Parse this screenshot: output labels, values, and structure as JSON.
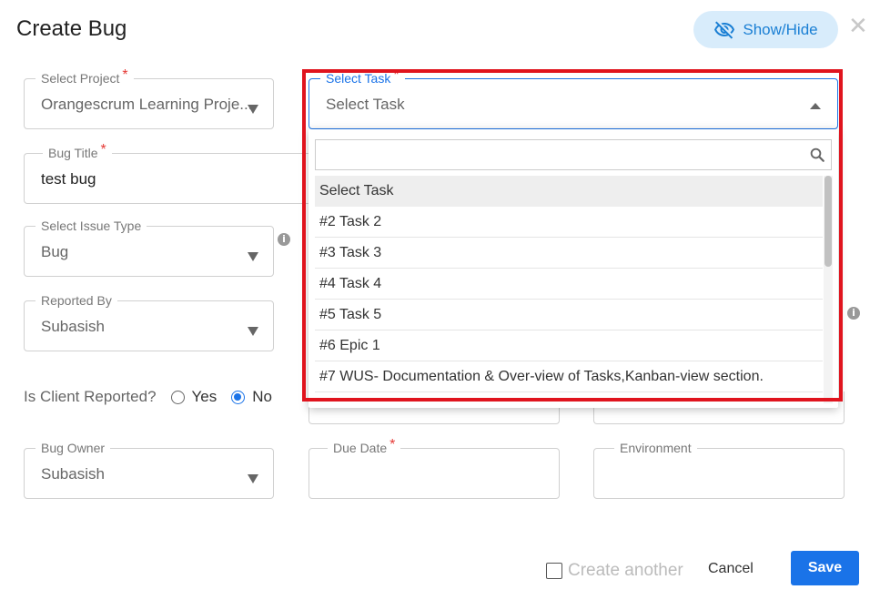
{
  "dialog": {
    "title": "Create Bug",
    "show_hide_label": "Show/Hide"
  },
  "fields": {
    "project": {
      "label": "Select Project",
      "value": "Orangescrum Learning Proje..."
    },
    "task": {
      "label": "Select Task",
      "value": "Select Task"
    },
    "bug_title": {
      "label": "Bug Title",
      "value": "test bug"
    },
    "issue_type": {
      "label": "Select Issue Type",
      "value": "Bug"
    },
    "reported_by": {
      "label": "Reported By",
      "value": "Subasish"
    },
    "bug_owner": {
      "label": "Bug Owner",
      "value": "Subasish"
    },
    "due_date": {
      "label": "Due Date",
      "value": ""
    },
    "environment": {
      "label": "Environment",
      "value": ""
    }
  },
  "client_reported": {
    "label": "Is Client Reported?",
    "yes": "Yes",
    "no": "No",
    "selected": "No"
  },
  "task_dropdown": {
    "search_placeholder": "",
    "options": [
      "Select Task",
      "#2 Task 2",
      "#3 Task 3",
      "#4 Task 4",
      "#5 Task 5",
      "#6 Epic 1",
      "#7 WUS- Documentation & Over-view of Tasks,Kanban-view section."
    ],
    "selected_index": 0
  },
  "footer": {
    "create_another": "Create another",
    "cancel": "Cancel",
    "save": "Save"
  },
  "colors": {
    "accent": "#1a73e8",
    "highlight": "#e0141e",
    "required": "#e53935"
  }
}
